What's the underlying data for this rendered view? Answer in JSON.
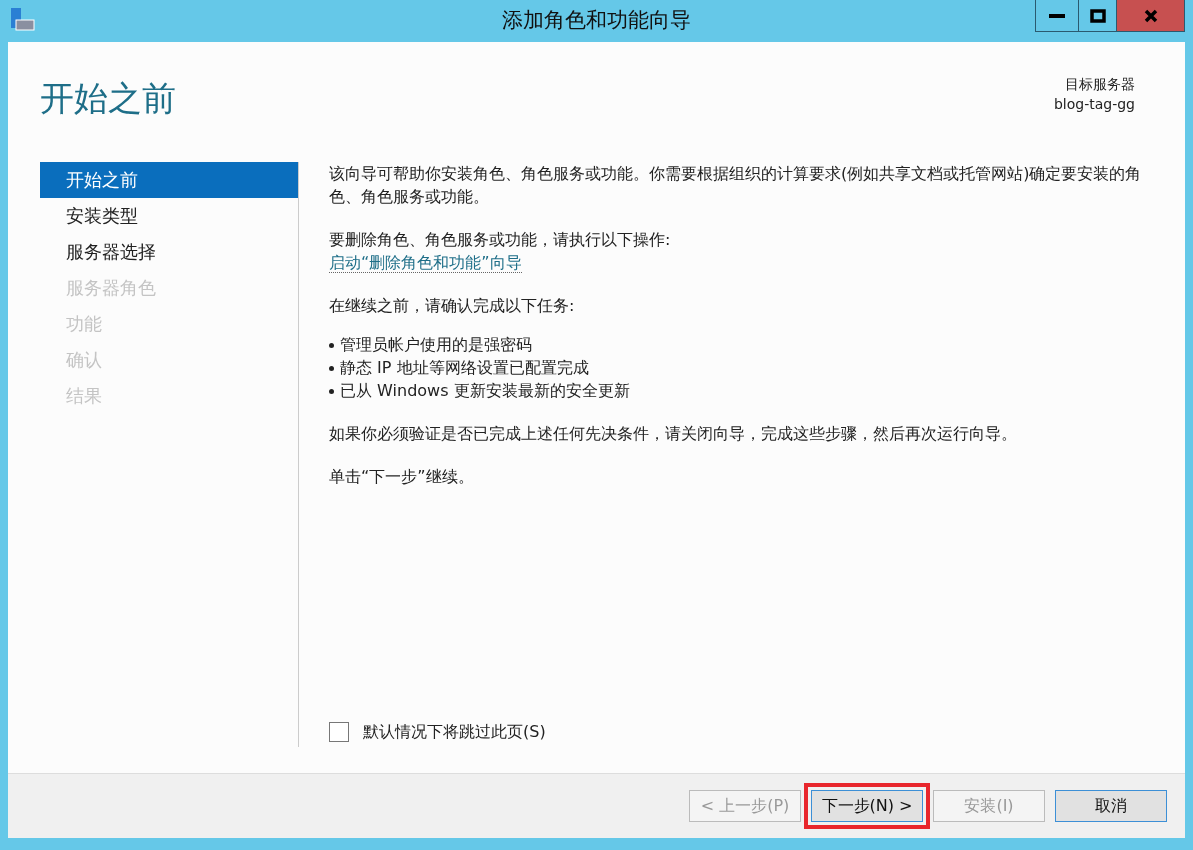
{
  "window": {
    "title": "添加角色和功能向导"
  },
  "header": {
    "title": "开始之前",
    "target_label": "目标服务器",
    "target_server": "blog-tag-gg"
  },
  "steps": [
    {
      "label": "开始之前",
      "selected": true,
      "disabled": false
    },
    {
      "label": "安装类型",
      "selected": false,
      "disabled": false
    },
    {
      "label": "服务器选择",
      "selected": false,
      "disabled": false
    },
    {
      "label": "服务器角色",
      "selected": false,
      "disabled": true
    },
    {
      "label": "功能",
      "selected": false,
      "disabled": true
    },
    {
      "label": "确认",
      "selected": false,
      "disabled": true
    },
    {
      "label": "结果",
      "selected": false,
      "disabled": true
    }
  ],
  "content": [
    {
      "kind": "paragraph",
      "text": "该向导可帮助你安装角色、角色服务或功能。你需要根据组织的计算要求(例如共享文档或托管网站)确定要安装的角色、角色服务或功能。"
    },
    {
      "kind": "paragraph",
      "text": "要删除角色、角色服务或功能，请执行以下操作:",
      "link": "启动“删除角色和功能”向导"
    },
    {
      "kind": "paragraph",
      "text": "在继续之前，请确认完成以下任务:"
    },
    {
      "kind": "bullets",
      "items": [
        "管理员帐户使用的是强密码",
        "静态 IP 地址等网络设置已配置完成",
        "已从 Windows 更新安装最新的安全更新"
      ]
    },
    {
      "kind": "paragraph",
      "text": "如果你必须验证是否已完成上述任何先决条件，请关闭向导，完成这些步骤，然后再次运行向导。"
    },
    {
      "kind": "paragraph",
      "text": "单击“下一步”继续。"
    }
  ],
  "skip_checkbox": {
    "label": "默认情况下将跳过此页(S)",
    "checked": false
  },
  "buttons": [
    {
      "label": "< 上一步(P)",
      "disabled": true,
      "highlighted": false
    },
    {
      "label": "下一步(N) >",
      "disabled": false,
      "highlighted": true
    },
    {
      "label": "安装(I)",
      "disabled": true,
      "highlighted": false
    },
    {
      "label": "取消",
      "disabled": false,
      "highlighted": false
    }
  ]
}
